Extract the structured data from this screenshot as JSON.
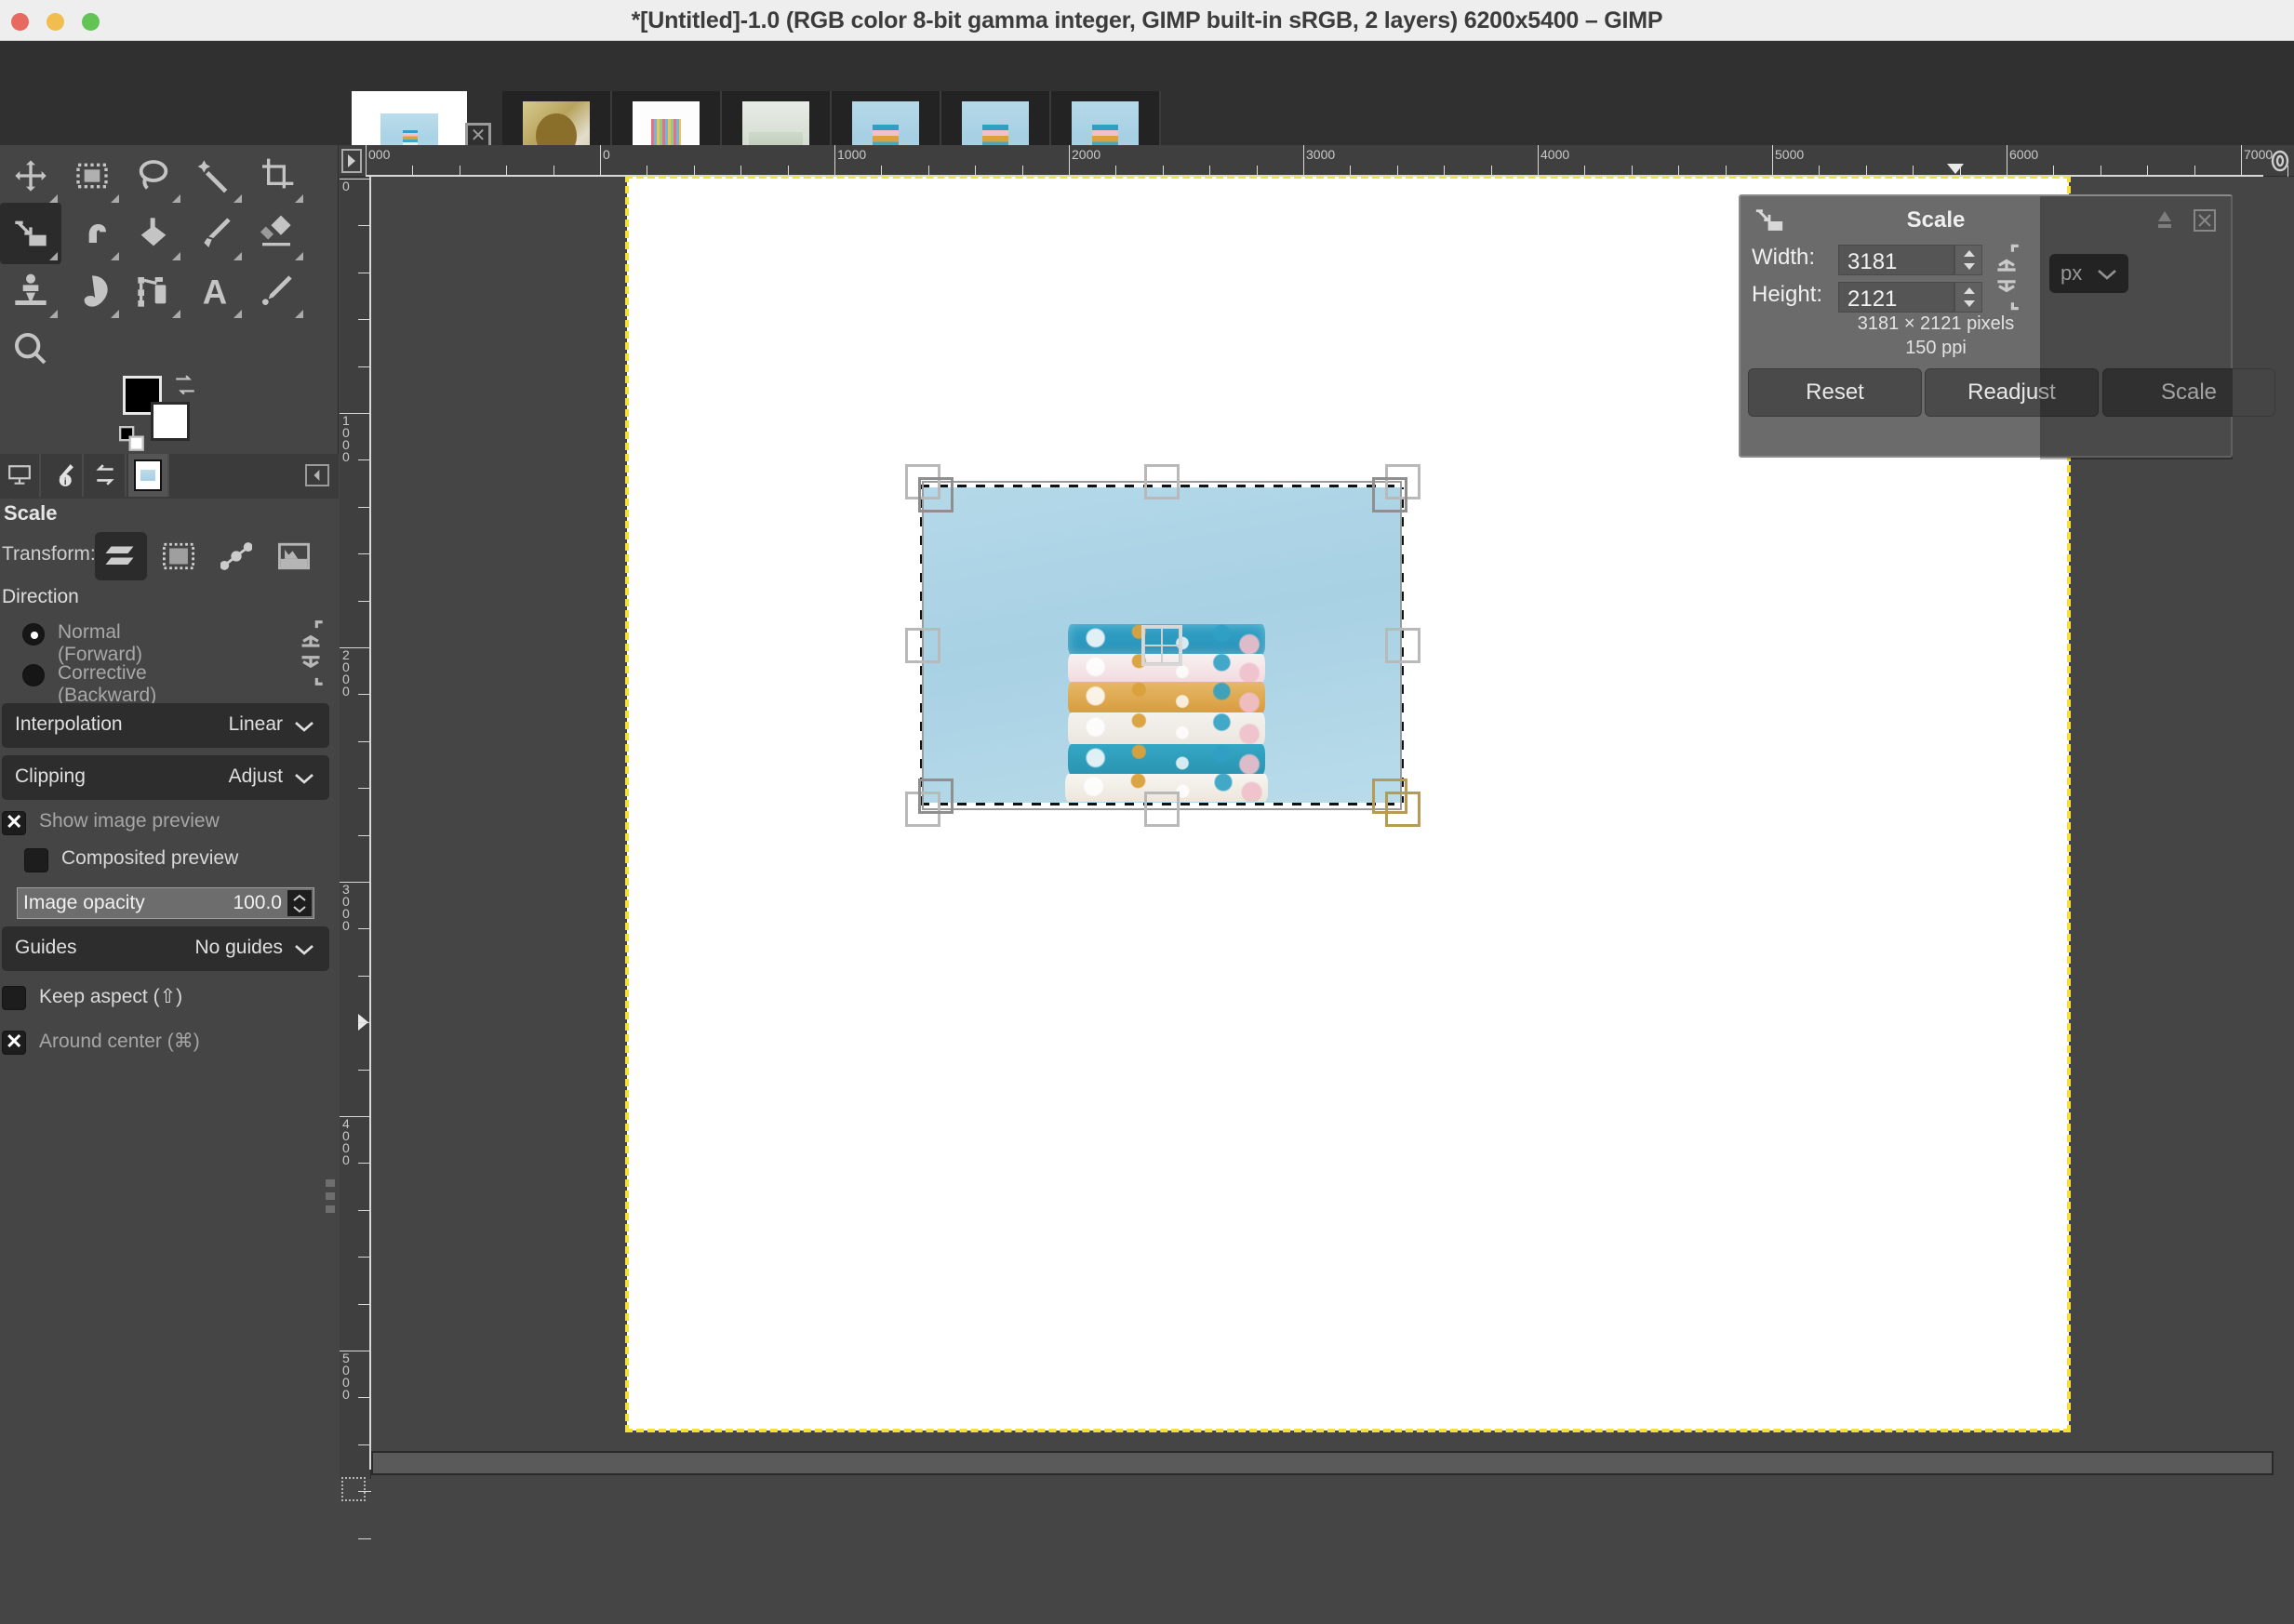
{
  "window": {
    "title": "*[Untitled]-1.0 (RGB color 8-bit gamma integer, GIMP built-in sRGB, 2 layers) 6200x5400 – GIMP",
    "traffic_lights": {
      "close": "#e8695f",
      "minimize": "#f0bd4e",
      "maximize": "#61c454"
    }
  },
  "thumbstrip": {
    "active_thumb_name": "untitled-document-thumbnail",
    "close_label": "✕",
    "items": [
      {
        "name": "thumbnail-craft-supplies"
      },
      {
        "name": "thumbnail-colored-pencils"
      },
      {
        "name": "thumbnail-bedding"
      },
      {
        "name": "thumbnail-fabric-stack-1"
      },
      {
        "name": "thumbnail-fabric-stack-2"
      },
      {
        "name": "thumbnail-fabric-stack-3"
      }
    ]
  },
  "toolbox": {
    "tools": [
      {
        "name": "move-tool",
        "label": "Move"
      },
      {
        "name": "rectangle-select-tool",
        "label": "Rectangle Select"
      },
      {
        "name": "free-select-tool",
        "label": "Free Select"
      },
      {
        "name": "fuzzy-select-tool",
        "label": "Fuzzy Select"
      },
      {
        "name": "crop-tool",
        "label": "Crop"
      },
      {
        "name": "scale-tool",
        "label": "Scale",
        "selected": true
      },
      {
        "name": "warp-transform-tool",
        "label": "Warp Transform"
      },
      {
        "name": "bucket-fill-tool",
        "label": "Bucket Fill"
      },
      {
        "name": "paintbrush-tool",
        "label": "Paintbrush"
      },
      {
        "name": "eraser-tool",
        "label": "Eraser"
      },
      {
        "name": "clone-tool",
        "label": "Clone"
      },
      {
        "name": "smudge-tool",
        "label": "Smudge"
      },
      {
        "name": "paths-tool",
        "label": "Paths"
      },
      {
        "name": "text-tool",
        "label": "Text"
      },
      {
        "name": "color-picker-tool",
        "label": "Color Picker"
      },
      {
        "name": "zoom-tool",
        "label": "Zoom"
      }
    ],
    "foreground_color": "#000000",
    "background_color": "#ffffff"
  },
  "tool_options": {
    "dock_tabs": [
      {
        "name": "tab-tool-options"
      },
      {
        "name": "tab-device-status"
      },
      {
        "name": "tab-undo-history"
      },
      {
        "name": "tab-images",
        "active": true
      }
    ],
    "title": "Scale",
    "transform_label": "Transform:",
    "transform_targets": [
      {
        "name": "transform-layer",
        "active": true
      },
      {
        "name": "transform-selection",
        "active": false
      },
      {
        "name": "transform-path",
        "active": false
      },
      {
        "name": "transform-image",
        "active": false
      }
    ],
    "direction_heading": "Direction",
    "direction_options": [
      {
        "label": "Normal (Forward)",
        "selected": true
      },
      {
        "label": "Corrective (Backward)",
        "selected": false
      }
    ],
    "interpolation": {
      "label": "Interpolation",
      "value": "Linear"
    },
    "clipping": {
      "label": "Clipping",
      "value": "Adjust"
    },
    "show_image_preview": {
      "label": "Show image preview",
      "checked": true
    },
    "composited_preview": {
      "label": "Composited preview",
      "checked": false
    },
    "image_opacity": {
      "label": "Image opacity",
      "value": "100.0"
    },
    "guides": {
      "label": "Guides",
      "value": "No guides"
    },
    "keep_aspect": {
      "label": "Keep aspect (⇧)",
      "checked": false
    },
    "around_center": {
      "label": "Around center (⌘)",
      "checked": true
    }
  },
  "rulers": {
    "unit": "px",
    "horizontal_labels": [
      "000",
      "0",
      "1000",
      "2000",
      "3000",
      "4000",
      "5000",
      "6000",
      "7000"
    ],
    "vertical_labels": [
      "0",
      "1000",
      "2000",
      "3000",
      "4000",
      "5000"
    ]
  },
  "scale_dialog": {
    "title": "Scale",
    "width_label": "Width:",
    "width_value": "3181",
    "height_label": "Height:",
    "height_value": "2121",
    "unit_value": "px",
    "info_size": "3181 × 2121 pixels",
    "info_ppi": "150 ppi",
    "buttons": {
      "reset": "Reset",
      "readjust": "Readjust",
      "scale": "Scale"
    },
    "detach_icon": "detach-icon",
    "close_icon": "✕"
  },
  "canvas": {
    "document_background": "#ffffff",
    "layer_boundary_color": "#f5e03a",
    "image_description": "stack-of-patterned-folded-fabrics-on-light-blue-background"
  }
}
